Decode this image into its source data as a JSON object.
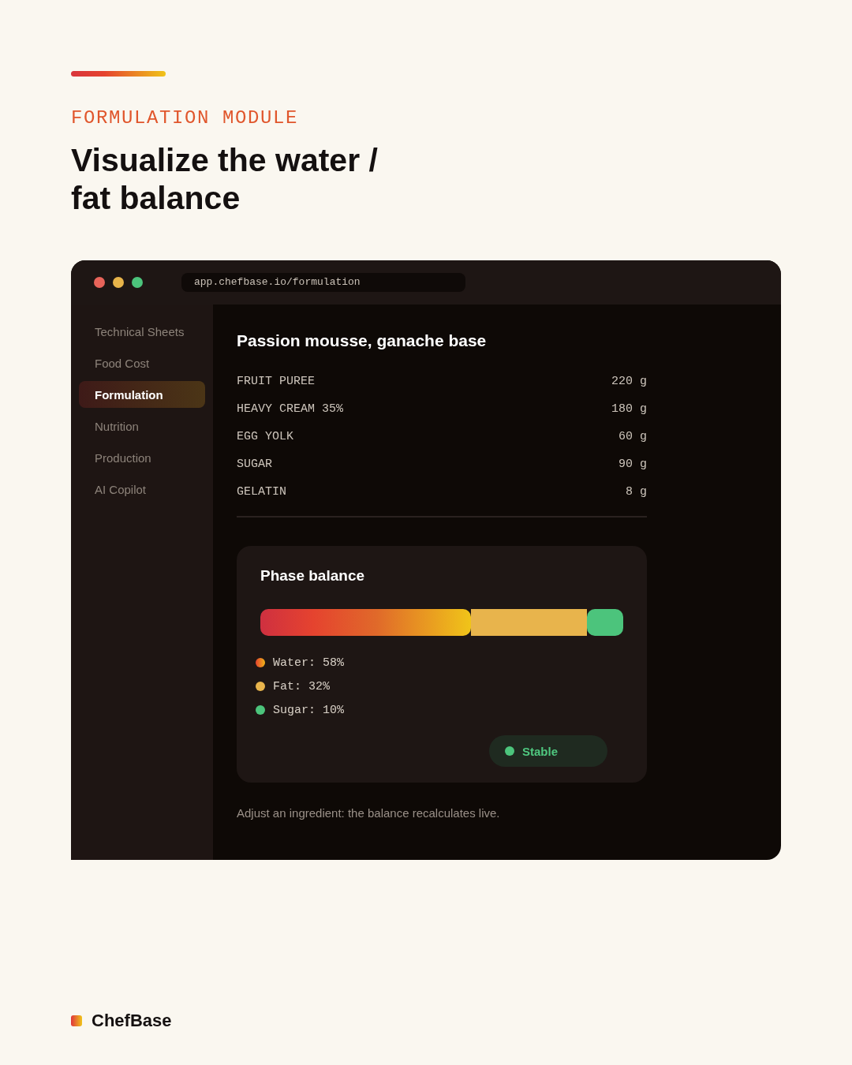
{
  "hero": {
    "eyebrow": "FORMULATION MODULE",
    "title": "Visualize the water / fat balance"
  },
  "browser": {
    "url": "app.chefbase.io/formulation"
  },
  "sidebar": {
    "items": [
      {
        "label": "Technical Sheets",
        "selected": false
      },
      {
        "label": "Food Cost",
        "selected": false
      },
      {
        "label": "Formulation",
        "selected": true
      },
      {
        "label": "Nutrition",
        "selected": false
      },
      {
        "label": "Production",
        "selected": false
      },
      {
        "label": "AI Copilot",
        "selected": false
      }
    ]
  },
  "recipe": {
    "title": "Passion mousse, ganache base",
    "ingredients": [
      {
        "name": "FRUIT PUREE",
        "amount": "220 g"
      },
      {
        "name": "HEAVY CREAM 35%",
        "amount": "180 g"
      },
      {
        "name": "EGG YOLK",
        "amount": "60 g"
      },
      {
        "name": "SUGAR",
        "amount": "90 g"
      },
      {
        "name": "GELATIN",
        "amount": "8 g"
      }
    ]
  },
  "phase_card": {
    "title": "Phase balance",
    "phases": [
      {
        "label": "Water: 58%",
        "level": 0.58,
        "kind": "gradient"
      },
      {
        "label": "Fat: 32%",
        "level": 0.32,
        "kind": "solid",
        "color": "#e8b44c"
      },
      {
        "label": "Sugar: 10%",
        "level": 0.1,
        "kind": "solid",
        "color": "#4cc47c"
      }
    ],
    "status": {
      "label": "Stable",
      "kind": "stable"
    }
  },
  "hint": "Adjust an ingredient: the balance recalculates live.",
  "brand": {
    "name": "ChefBase"
  }
}
